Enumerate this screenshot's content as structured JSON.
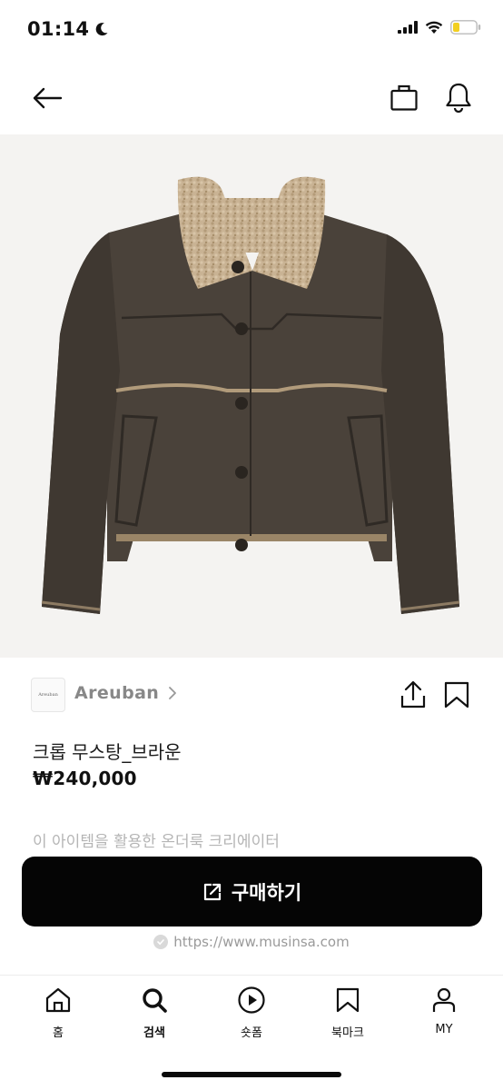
{
  "status_bar": {
    "time": "01:14"
  },
  "brand": {
    "logo_text": "Areuban",
    "name": "Areuban"
  },
  "product": {
    "title": "크롭 무스탕_브라운",
    "price": "₩240,000"
  },
  "creator_section": {
    "text": "이 아이템을 활용한 온더룩 크리에이터"
  },
  "buy_button": {
    "label": "구매하기"
  },
  "source": {
    "url": "https://www.musinsa.com"
  },
  "tabs": [
    {
      "label": "홈",
      "icon": "home-icon"
    },
    {
      "label": "검색",
      "icon": "search-icon",
      "active": true
    },
    {
      "label": "숏폼",
      "icon": "play-icon"
    },
    {
      "label": "북마크",
      "icon": "bookmark-icon"
    },
    {
      "label": "MY",
      "icon": "person-icon"
    }
  ],
  "colors": {
    "primary": "#050505",
    "muted": "#9a9a9a",
    "image_bg": "#f4f3f1"
  }
}
